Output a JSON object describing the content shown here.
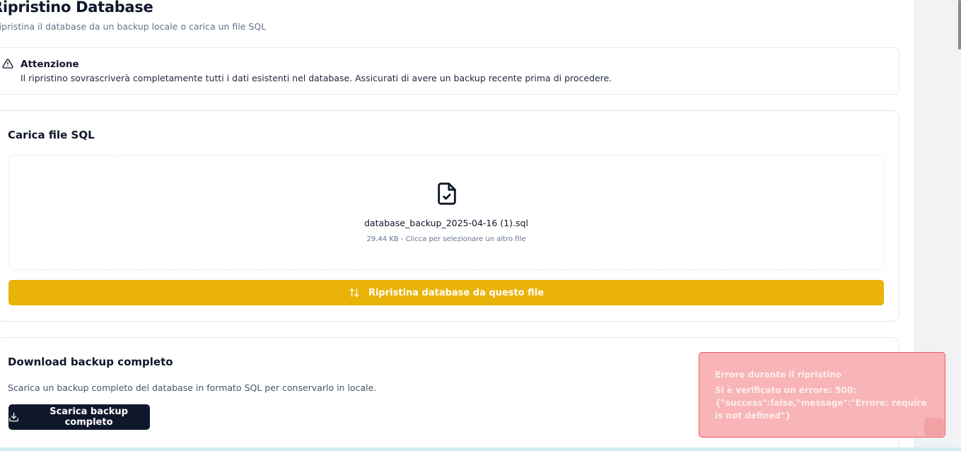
{
  "header": {
    "title": "Ripristino Database",
    "subtitle": "Ripristina il database da un backup locale o carica un file SQL"
  },
  "warning": {
    "icon": "alert-triangle-icon",
    "title": "Attenzione",
    "text": "Il ripristino sovrascriverà completamente tutti i dati esistenti nel database. Assicurati di avere un backup recente prima di procedere."
  },
  "upload": {
    "title": "Carica file SQL",
    "file_icon": "file-check-icon",
    "file_name": "database_backup_2025-04-16 (1).sql",
    "file_meta": "29.44 KB - Clicca per selezionare un altro file",
    "restore_icon": "arrow-up-down-icon",
    "restore_label": "Ripristina database da questo file"
  },
  "download": {
    "title": "Download backup completo",
    "description": "Scarica un backup completo del database in formato SQL per conservarlo in locale.",
    "button_icon": "download-icon",
    "button_label": "Scarica backup completo"
  },
  "toast": {
    "title": "Errore durante il ripristino",
    "message": "Si è verificato un errore: 500: {\"success\":false,\"message\":\"Errore: require is not defined\"}"
  },
  "colors": {
    "accent": "#eab308",
    "primary": "#0f172a",
    "error_bg": "#f8b4b6",
    "error_border": "#ef5a60"
  }
}
